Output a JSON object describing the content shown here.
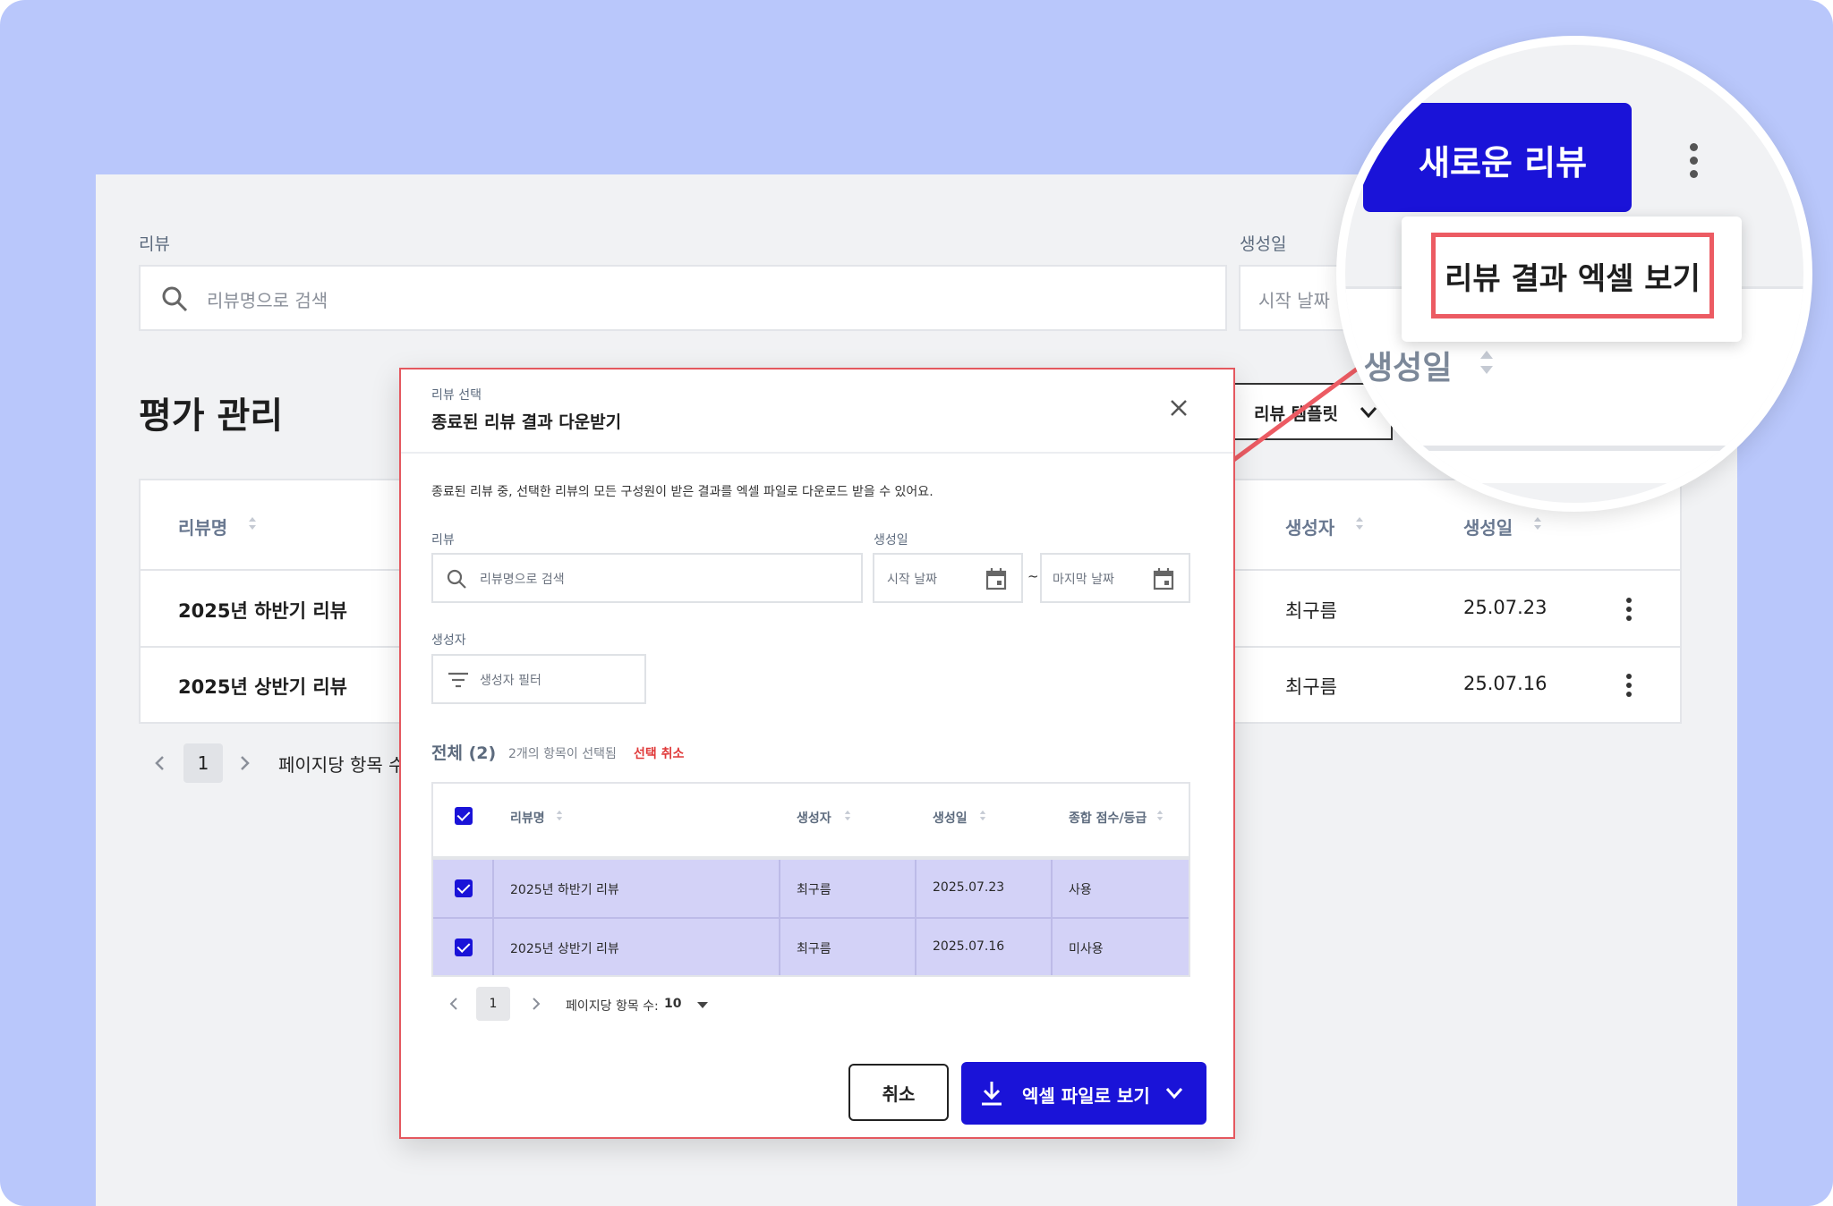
{
  "filters": {
    "review_label": "리뷰",
    "review_placeholder": "리뷰명으로 검색",
    "date_label": "생성일",
    "start_placeholder": "시작 날짜"
  },
  "page_title": "평가 관리",
  "toolbar": {
    "template_label": "리뷰 템플릿"
  },
  "table": {
    "headers": {
      "name": "리뷰명",
      "creator": "생성자",
      "created": "생성일"
    },
    "rows": [
      {
        "name": "2025년 하반기 리뷰",
        "creator": "최구름",
        "created": "25.07.23"
      },
      {
        "name": "2025년 상반기 리뷰",
        "creator": "최구름",
        "created": "25.07.16"
      }
    ]
  },
  "pagination": {
    "page": "1",
    "per_page_label": "페이지당 항목 수"
  },
  "modal": {
    "eyebrow": "리뷰 선택",
    "title": "종료된 리뷰 결과 다운받기",
    "description": "종료된 리뷰 중, 선택한 리뷰의 모든 구성원이 받은 결과를 엑셀 파일로 다운로드 받을 수 있어요.",
    "review_label": "리뷰",
    "review_placeholder": "리뷰명으로 검색",
    "date_label": "생성일",
    "start_placeholder": "시작 날짜",
    "range_sep": "~",
    "end_placeholder": "마지막 날짜",
    "creator_label": "생성자",
    "creator_placeholder": "생성자 필터",
    "all_label": "전체 (2)",
    "selected_count": "2개의 항목이 선택됨",
    "deselect": "선택 취소",
    "headers": {
      "name": "리뷰명",
      "creator": "생성자",
      "created": "생성일",
      "score": "종합 점수/등급"
    },
    "rows": [
      {
        "name": "2025년 하반기 리뷰",
        "creator": "최구름",
        "created": "2025.07.23",
        "score": "사용"
      },
      {
        "name": "2025년 상반기 리뷰",
        "creator": "최구름",
        "created": "2025.07.16",
        "score": "미사용"
      }
    ],
    "page": "1",
    "per_page_label": "페이지당 항목 수:",
    "per_page_value": "10",
    "cancel": "취소",
    "excel": "엑셀 파일로 보기"
  },
  "magnifier": {
    "new_review": "새로운 리뷰",
    "menu_item": "리뷰 결과 엑셀 보기",
    "column": "생성일"
  },
  "colors": {
    "accent": "#1a13d8",
    "highlight": "#ec5b63",
    "backdrop": "#b9c7fb",
    "selected_row": "#d3d2f7"
  }
}
